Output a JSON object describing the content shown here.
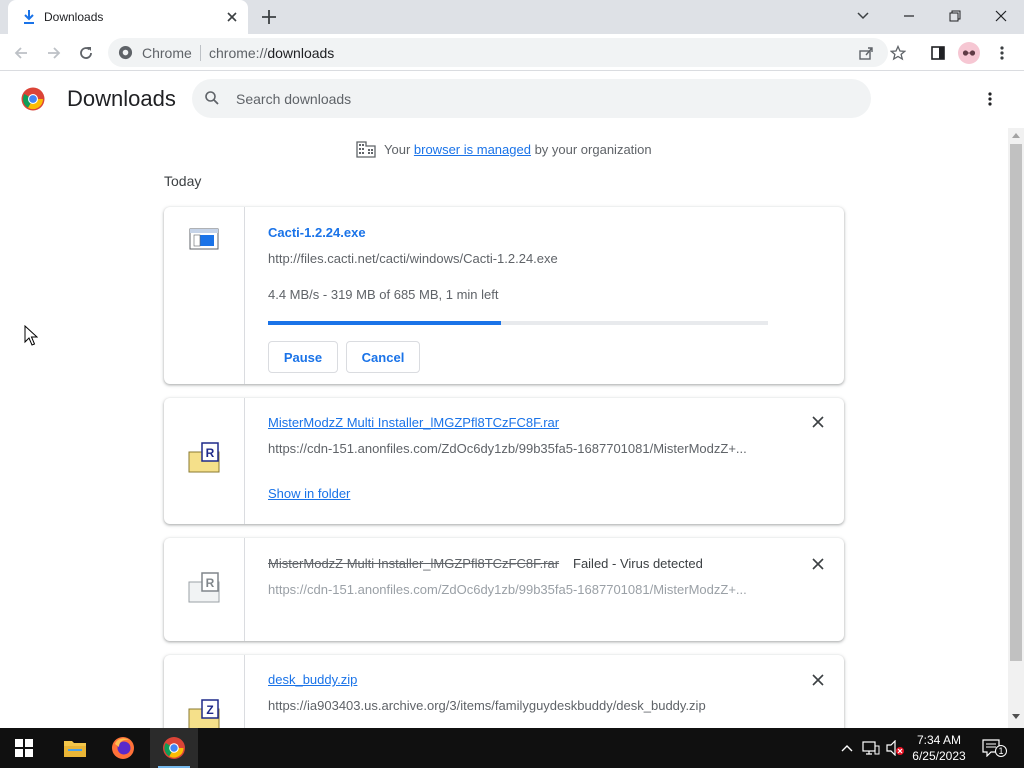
{
  "tab": {
    "title": "Downloads"
  },
  "omnibox": {
    "site": "Chrome",
    "url_scheme": "chrome://",
    "url_path": "downloads"
  },
  "page": {
    "title": "Downloads"
  },
  "search": {
    "placeholder": "Search downloads"
  },
  "managed": {
    "before": "Your ",
    "link": "browser is managed",
    "after": " by your organization"
  },
  "section": {
    "date": "Today"
  },
  "downloads": [
    {
      "filename": "Cacti-1.2.24.exe",
      "url": "http://files.cacti.net/cacti/windows/Cacti-1.2.24.exe",
      "progress_text": "4.4 MB/s - 319 MB of 685 MB, 1 min left",
      "progress_fraction": 0.466,
      "pause_label": "Pause",
      "cancel_label": "Cancel",
      "icon": "exe-file-icon"
    },
    {
      "filename": "MisterModzZ Multi Installer_lMGZPfl8TCzFC8F.rar",
      "url": "https://cdn-151.anonfiles.com/ZdOc6dy1zb/99b35fa5-1687701081/MisterModzZ+...",
      "link_label": "Show in folder",
      "icon": "rar-file-icon"
    },
    {
      "filename": "MisterModzZ Multi Installer_lMGZPfl8TCzFC8F.rar",
      "status": "Failed - Virus detected",
      "url": "https://cdn-151.anonfiles.com/ZdOc6dy1zb/99b35fa5-1687701081/MisterModzZ+...",
      "icon": "rar-file-icon-disabled"
    },
    {
      "filename": "desk_buddy.zip",
      "url": "https://ia903403.us.archive.org/3/items/familyguydeskbuddy/desk_buddy.zip",
      "icon": "zip-file-icon"
    }
  ],
  "taskbar": {
    "time": "7:34 AM",
    "date": "6/25/2023",
    "notification_count": "1"
  },
  "colors": {
    "accent": "#1a73e8",
    "tabstrip": "#dee1e6",
    "taskbar": "#101010"
  }
}
